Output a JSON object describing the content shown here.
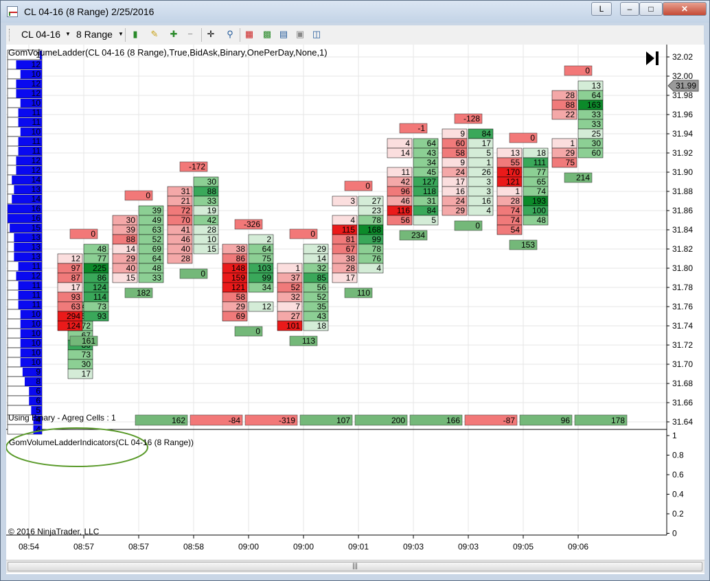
{
  "window": {
    "title": "CL 04-16 (8 Range)  2/25/2016",
    "caption_letter": "L"
  },
  "toolbar": {
    "instrument": "CL 04-16",
    "period": "8 Range"
  },
  "chart": {
    "indicator_label": "GomVolumeLadder(CL  04-16  (8  Range),True,BidAsk,Binary,OnePerDay,None,1)",
    "agreg_label": "Using Binary - Agreg Cells : 1",
    "indicator_panel_label": "GomVolumeLadderIndicators(CL 04-16 (8 Range))",
    "copyright": "© 2016 NinjaTrader, LLC",
    "last_price": "31.99",
    "price_axis": [
      "32.02",
      "32.00",
      "31.98",
      "31.96",
      "31.94",
      "31.92",
      "31.90",
      "31.88",
      "31.86",
      "31.84",
      "31.82",
      "31.80",
      "31.78",
      "31.76",
      "31.74",
      "31.72",
      "31.70",
      "31.68",
      "31.66",
      "31.64"
    ],
    "indicator_axis": [
      "1",
      "0.8",
      "0.6",
      "0.4",
      "0.2",
      "0"
    ],
    "time_axis": [
      "08:54",
      "08:57",
      "08:57",
      "08:58",
      "09:00",
      "09:00",
      "09:01",
      "09:03",
      "09:03",
      "09:05",
      "09:06"
    ],
    "bottom_totals": [
      "162",
      "-84",
      "-319",
      "107",
      "200",
      "166",
      "-87",
      "96",
      "178"
    ],
    "colors": {
      "bid": "#e5282a",
      "ask": "#2f9a3a",
      "profile": "#0a0af0",
      "poc": "#2ad6e0",
      "open": "#f0a020"
    },
    "profile": [
      {
        "v": "1"
      },
      {
        "v": "12"
      },
      {
        "v": "10"
      },
      {
        "v": "12"
      },
      {
        "v": "12"
      },
      {
        "v": "10"
      },
      {
        "v": "11"
      },
      {
        "v": "11"
      },
      {
        "v": "10"
      },
      {
        "v": "11"
      },
      {
        "v": "11"
      },
      {
        "v": "12"
      },
      {
        "v": "12"
      },
      {
        "v": "14"
      },
      {
        "v": "13"
      },
      {
        "v": "14"
      },
      {
        "v": "16"
      },
      {
        "v": "16"
      },
      {
        "v": "15"
      },
      {
        "v": "13"
      },
      {
        "v": "13"
      },
      {
        "v": "13"
      },
      {
        "v": "11"
      },
      {
        "v": "12"
      },
      {
        "v": "11"
      },
      {
        "v": "11"
      },
      {
        "v": "11"
      },
      {
        "v": "10"
      },
      {
        "v": "10"
      },
      {
        "v": "10"
      },
      {
        "v": "10"
      },
      {
        "v": "10"
      },
      {
        "v": "10"
      },
      {
        "v": "9"
      },
      {
        "v": "8"
      },
      {
        "v": "6"
      },
      {
        "v": "6"
      },
      {
        "v": "5"
      },
      {
        "v": "4"
      },
      {
        "v": "4"
      }
    ],
    "bars": [
      {
        "top": 31.76,
        "cells": [
          [
            "",
            "44"
          ],
          [
            "",
            "54"
          ],
          [
            "",
            "72"
          ],
          [
            "",
            "67"
          ],
          [
            "",
            "80"
          ],
          [
            "",
            "73"
          ],
          [
            "",
            "30"
          ],
          [
            "",
            "17"
          ]
        ],
        "delta": "",
        "total": ""
      },
      {
        "top": 31.82,
        "cells": [
          [
            "",
            "48"
          ],
          [
            "12",
            "77"
          ],
          [
            "97",
            "225"
          ],
          [
            "87",
            "86"
          ],
          [
            "17",
            "124"
          ],
          [
            "93",
            "114"
          ],
          [
            "63",
            "73"
          ],
          [
            "294",
            "93"
          ],
          [
            "124",
            ""
          ]
        ],
        "delta": "0",
        "total": "161"
      },
      {
        "top": 31.86,
        "cells": [
          [
            "",
            "39"
          ],
          [
            "30",
            "49"
          ],
          [
            "39",
            "63"
          ],
          [
            "88",
            "52"
          ],
          [
            "14",
            "69"
          ],
          [
            "29",
            "64"
          ],
          [
            "40",
            "48"
          ],
          [
            "15",
            "33"
          ]
        ],
        "delta": "0",
        "total": "182"
      },
      {
        "top": 31.89,
        "cells": [
          [
            "",
            "30"
          ],
          [
            "31",
            "88"
          ],
          [
            "21",
            "33"
          ],
          [
            "72",
            "19"
          ],
          [
            "70",
            "42"
          ],
          [
            "41",
            "28"
          ],
          [
            "46",
            "10"
          ],
          [
            "40",
            "15"
          ],
          [
            "28",
            ""
          ]
        ],
        "delta": "-172",
        "total": "0"
      },
      {
        "top": 31.83,
        "cells": [
          [
            "",
            "2"
          ],
          [
            "38",
            "64"
          ],
          [
            "86",
            "75"
          ],
          [
            "148",
            "103"
          ],
          [
            "159",
            "99"
          ],
          [
            "121",
            "34"
          ],
          [
            "58",
            ""
          ],
          [
            "29",
            "12"
          ],
          [
            "69",
            ""
          ]
        ],
        "delta": "-326",
        "total": "0"
      },
      {
        "top": 31.82,
        "cells": [
          [
            "",
            "29"
          ],
          [
            "",
            "14"
          ],
          [
            "1",
            "32"
          ],
          [
            "37",
            "85"
          ],
          [
            "52",
            "56"
          ],
          [
            "32",
            "52"
          ],
          [
            "7",
            "35"
          ],
          [
            "27",
            "43"
          ],
          [
            "101",
            "18"
          ]
        ],
        "delta": "0",
        "total": "113"
      },
      {
        "top": 31.87,
        "cells": [
          [
            "3",
            "27"
          ],
          [
            "",
            "23"
          ],
          [
            "4",
            "78"
          ],
          [
            "115",
            "168"
          ],
          [
            "81",
            "99"
          ],
          [
            "67",
            "78"
          ],
          [
            "38",
            "76"
          ],
          [
            "28",
            "4"
          ],
          [
            "17",
            ""
          ]
        ],
        "delta": "0",
        "total": "110"
      },
      {
        "top": 31.93,
        "cells": [
          [
            "4",
            "64"
          ],
          [
            "14",
            "43"
          ],
          [
            "",
            "34"
          ],
          [
            "11",
            "45"
          ],
          [
            "42",
            "127"
          ],
          [
            "96",
            "118"
          ],
          [
            "46",
            "31"
          ],
          [
            "116",
            "84"
          ],
          [
            "56",
            "5"
          ]
        ],
        "delta": "-1",
        "total": "234"
      },
      {
        "top": 31.94,
        "cells": [
          [
            "9",
            "84"
          ],
          [
            "60",
            "17"
          ],
          [
            "58",
            "5"
          ],
          [
            "9",
            "1"
          ],
          [
            "24",
            "26"
          ],
          [
            "17",
            "3"
          ],
          [
            "16",
            "3"
          ],
          [
            "24",
            "16"
          ],
          [
            "29",
            "4"
          ]
        ],
        "delta": "-128",
        "total": "0"
      },
      {
        "top": 31.92,
        "cells": [
          [
            "13",
            "18"
          ],
          [
            "55",
            "111"
          ],
          [
            "170",
            "77"
          ],
          [
            "121",
            "65"
          ],
          [
            "1",
            "74"
          ],
          [
            "28",
            "193"
          ],
          [
            "74",
            "100"
          ],
          [
            "74",
            "48"
          ],
          [
            "54",
            ""
          ]
        ],
        "delta": "0",
        "total": "153"
      },
      {
        "top": 31.99,
        "cells": [
          [
            "",
            "13"
          ],
          [
            "28",
            "64"
          ],
          [
            "88",
            "163"
          ],
          [
            "22",
            "33"
          ],
          [
            "",
            "33"
          ],
          [
            "",
            "25"
          ],
          [
            "1",
            "30"
          ],
          [
            "29",
            "60"
          ],
          [
            "75",
            ""
          ]
        ],
        "delta": "0",
        "total": "214"
      }
    ]
  }
}
